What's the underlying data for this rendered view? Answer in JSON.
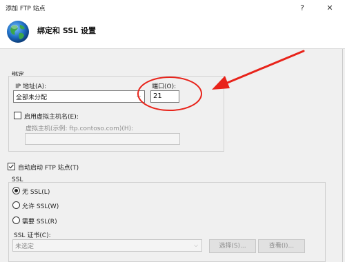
{
  "window": {
    "title": "添加 FTP 站点",
    "help_glyph": "?",
    "close_glyph": "✕"
  },
  "header": {
    "title": "绑定和 SSL 设置"
  },
  "binding": {
    "group_label": "绑定",
    "ip_label": "IP 地址(A):",
    "ip_value": "全部未分配",
    "port_label": "端口(O):",
    "port_value": "21",
    "vhost_checkbox_label": "启用虚拟主机名(E):",
    "vhost_checked": false,
    "vhost_label": "虚拟主机(示例: ftp.contoso.com)(H):",
    "vhost_value": ""
  },
  "autostart": {
    "label": "自动启动 FTP 站点(T)",
    "checked": true
  },
  "ssl": {
    "group_label": "SSL",
    "options": [
      {
        "label": "无 SSL(L)",
        "selected": true
      },
      {
        "label": "允许 SSL(W)",
        "selected": false
      },
      {
        "label": "需要 SSL(R)",
        "selected": false
      }
    ],
    "cert_label": "SSL 证书(C):",
    "cert_value": "未选定",
    "select_button": "选择(S)...",
    "view_button": "查看(I)..."
  },
  "annotation": {
    "color": "#e8231a"
  },
  "colors": {
    "panel": "#f0f0f0",
    "globe_blue": "#1f6fc5",
    "globe_green": "#3aa64a"
  },
  "icons": [
    "globe-icon",
    "chevron-down-icon",
    "checkmark-icon",
    "arrow-annotation"
  ]
}
